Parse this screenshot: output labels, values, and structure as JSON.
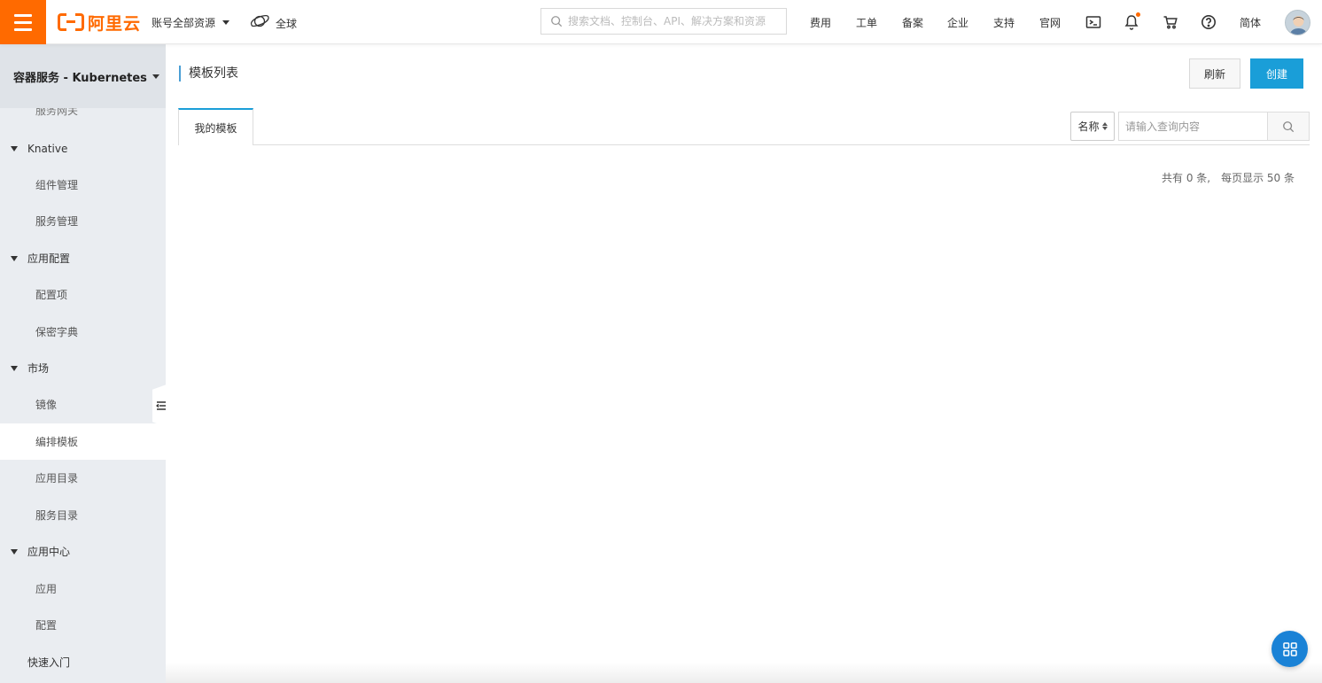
{
  "topbar": {
    "logo_text": "阿里云",
    "account_label": "账号全部资源",
    "region_label": "全球",
    "search_placeholder": "搜索文档、控制台、API、解决方案和资源",
    "nav": [
      "费用",
      "工单",
      "备案",
      "企业",
      "支持",
      "官网"
    ],
    "lang": "简体",
    "brand_color": "#ff6a00"
  },
  "sidebar": {
    "product_title": "容器服务 - Kubernetes",
    "items": [
      {
        "label": "服务网关",
        "type": "sub"
      },
      {
        "label": "Knative",
        "type": "group"
      },
      {
        "label": "组件管理",
        "type": "sub"
      },
      {
        "label": "服务管理",
        "type": "sub"
      },
      {
        "label": "应用配置",
        "type": "group"
      },
      {
        "label": "配置项",
        "type": "sub"
      },
      {
        "label": "保密字典",
        "type": "sub"
      },
      {
        "label": "市场",
        "type": "group"
      },
      {
        "label": "镜像",
        "type": "sub"
      },
      {
        "label": "编排模板",
        "type": "sub",
        "active": true
      },
      {
        "label": "应用目录",
        "type": "sub"
      },
      {
        "label": "服务目录",
        "type": "sub"
      },
      {
        "label": "应用中心",
        "type": "group"
      },
      {
        "label": "应用",
        "type": "sub"
      },
      {
        "label": "配置",
        "type": "sub"
      },
      {
        "label": "快速入门",
        "type": "group-plain"
      }
    ]
  },
  "main": {
    "title": "模板列表",
    "refresh_label": "刷新",
    "create_label": "创建",
    "tab_label": "我的模板",
    "filter_select": "名称",
    "query_placeholder": "请输入查询内容",
    "total_text": "共有 0 条,",
    "per_page_text": "每页显示 50 条",
    "accent_color": "#1a9ed8"
  }
}
